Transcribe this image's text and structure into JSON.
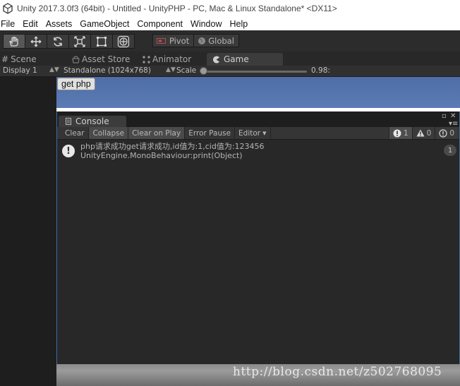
{
  "window": {
    "title": "Unity 2017.3.0f3 (64bit) - Untitled - UnityPHP - PC, Mac & Linux Standalone* <DX11>"
  },
  "menu": [
    "File",
    "Edit",
    "Assets",
    "GameObject",
    "Component",
    "Window",
    "Help"
  ],
  "toolbar": {
    "pivot_label": "Pivot",
    "global_label": "Global"
  },
  "tabs": [
    {
      "label": "Scene",
      "icon": "grid-icon"
    },
    {
      "label": "Asset Store",
      "icon": "store-icon"
    },
    {
      "label": "Animator",
      "icon": "animator-icon"
    },
    {
      "label": "Game",
      "icon": "pacman-icon"
    }
  ],
  "game_toolbar": {
    "display": "Display 1",
    "resolution": "Standalone (1024x768)",
    "scale_label": "Scale",
    "scale_value": "0.98:"
  },
  "game_view": {
    "button_label": "get php"
  },
  "console": {
    "tab_label": "Console",
    "buttons": [
      "Clear",
      "Collapse",
      "Clear on Play",
      "Error Pause",
      "Editor"
    ],
    "counts": {
      "info": "1",
      "warning": "0",
      "error": "0"
    },
    "entries": [
      {
        "line1": "php请求成功get请求成功,id值为:1,cid值为:123456",
        "line2": "UnityEngine.MonoBehaviour:print(Object)",
        "count": "1"
      }
    ]
  },
  "watermark": "http://blog.csdn.net/z502768095"
}
